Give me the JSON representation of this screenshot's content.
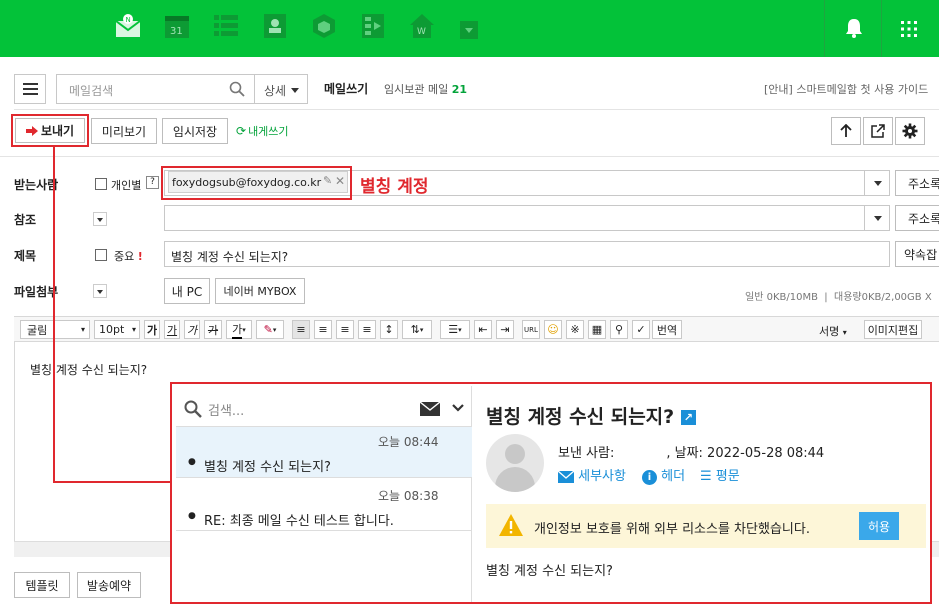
{
  "topbar": {
    "apps": [
      "mail-icon",
      "calendar-icon",
      "list-icon",
      "contacts-icon",
      "cube-icon",
      "video-icon",
      "works-icon"
    ],
    "calendar_day": "31",
    "works_letter": "W",
    "bell": "bell-icon",
    "grid": "grid-icon",
    "color": "#03c239"
  },
  "toolbar": {
    "search_placeholder": "메일검색",
    "detail_label": "상세",
    "compose_title": "메일쓰기",
    "drafts_label": "임시보관 메일",
    "drafts_count": "21",
    "guide_link": "[안내] 스마트메일함 첫 사용 가이드",
    "send_label": "보내기",
    "preview_label": "미리보기",
    "save_draft_label": "임시저장",
    "self_send_label": "내게쓰기"
  },
  "form": {
    "to_label": "받는사람",
    "individual_label": "개인별",
    "help_mark": "?",
    "recipient": "foxydogsub@foxydog.co.kr",
    "annotation": "별칭 계정",
    "address_book": "주소록",
    "cc_label": "참조",
    "subject_label": "제목",
    "important_label": "중요",
    "important_mark": "!",
    "subject_value": "별칭 계정 수신 되는지?",
    "sig_label": "약속잡",
    "attach_label": "파일첨부",
    "my_pc": "내 PC",
    "mybox": "네이버 MYBOX",
    "attach_info": "일반 0KB/10MB  |  대용량0KB/2,00GB X"
  },
  "editor": {
    "font": "굴림",
    "size": "10pt",
    "translate": "번역",
    "signature": "서명",
    "image_edit": "이미지편집",
    "body": "별칭 계정 수신 되는지?"
  },
  "bottom": {
    "template": "템플릿",
    "schedule": "발송예약"
  },
  "popup": {
    "search_placeholder": "검색...",
    "messages": [
      {
        "time": "오늘 08:44",
        "subject": "별칭 계정 수신 되는지?",
        "selected": true
      },
      {
        "time": "오늘 08:38",
        "subject": "RE: 최종 메일 수신 테스트 합니다.",
        "selected": false
      }
    ],
    "detail": {
      "title": "별칭 계정 수신 되는지?",
      "sender_label": "보낸 사람:",
      "date_text": ", 날짜: 2022-05-28 08:44",
      "details_link": "세부사항",
      "headers_link": "헤더",
      "plain_link": "평문",
      "warning": "개인정보 보호를 위해 외부 리소스를 차단했습니다.",
      "allow": "허용",
      "body": "별칭 계정 수신 되는지?"
    }
  }
}
